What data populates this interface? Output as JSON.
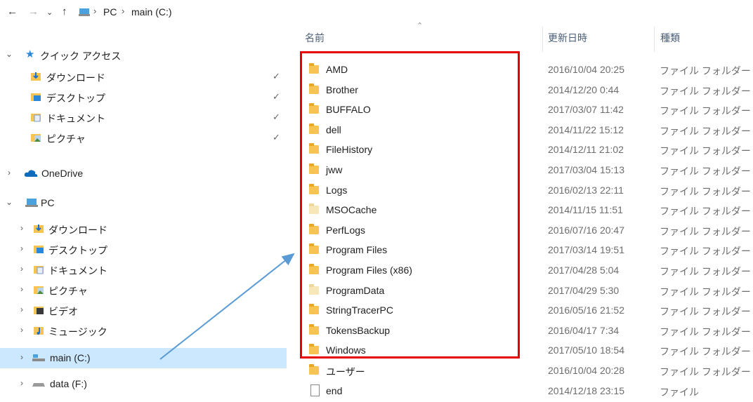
{
  "address_bar": {
    "back_icon": "arrow-left-icon",
    "forward_icon": "arrow-right-icon",
    "history_icon": "chevron-down-icon",
    "up_icon": "arrow-up-icon",
    "breadcrumbs": [
      "PC",
      "main (C:)"
    ]
  },
  "sidebar": {
    "quick_access": {
      "label": "クイック アクセス",
      "items": [
        {
          "label": "ダウンロード",
          "icon": "download-folder-icon"
        },
        {
          "label": "デスクトップ",
          "icon": "desktop-folder-icon"
        },
        {
          "label": "ドキュメント",
          "icon": "documents-folder-icon"
        },
        {
          "label": "ピクチャ",
          "icon": "pictures-folder-icon"
        }
      ]
    },
    "onedrive": {
      "label": "OneDrive"
    },
    "pc": {
      "label": "PC",
      "items": [
        {
          "label": "ダウンロード"
        },
        {
          "label": "デスクトップ"
        },
        {
          "label": "ドキュメント"
        },
        {
          "label": "ピクチャ"
        },
        {
          "label": "ビデオ"
        },
        {
          "label": "ミュージック"
        },
        {
          "label": "main (C:)",
          "selected": true
        },
        {
          "label": "data (F:)"
        }
      ]
    }
  },
  "columns": {
    "name": "名前",
    "date": "更新日時",
    "type": "種類"
  },
  "files": [
    {
      "name": "AMD",
      "date": "2016/10/04 20:25",
      "type": "ファイル フォルダー",
      "kind": "folder"
    },
    {
      "name": "Brother",
      "date": "2014/12/20 0:44",
      "type": "ファイル フォルダー",
      "kind": "folder"
    },
    {
      "name": "BUFFALO",
      "date": "2017/03/07 11:42",
      "type": "ファイル フォルダー",
      "kind": "folder"
    },
    {
      "name": "dell",
      "date": "2014/11/22 15:12",
      "type": "ファイル フォルダー",
      "kind": "folder"
    },
    {
      "name": "FileHistory",
      "date": "2014/12/11 21:02",
      "type": "ファイル フォルダー",
      "kind": "folder"
    },
    {
      "name": "jww",
      "date": "2017/03/04 15:13",
      "type": "ファイル フォルダー",
      "kind": "folder"
    },
    {
      "name": "Logs",
      "date": "2016/02/13 22:11",
      "type": "ファイル フォルダー",
      "kind": "folder"
    },
    {
      "name": "MSOCache",
      "date": "2014/11/15 11:51",
      "type": "ファイル フォルダー",
      "kind": "folder-hidden"
    },
    {
      "name": "PerfLogs",
      "date": "2016/07/16 20:47",
      "type": "ファイル フォルダー",
      "kind": "folder"
    },
    {
      "name": "Program Files",
      "date": "2017/03/14 19:51",
      "type": "ファイル フォルダー",
      "kind": "folder"
    },
    {
      "name": "Program Files (x86)",
      "date": "2017/04/28 5:04",
      "type": "ファイル フォルダー",
      "kind": "folder"
    },
    {
      "name": "ProgramData",
      "date": "2017/04/29 5:30",
      "type": "ファイル フォルダー",
      "kind": "folder-hidden"
    },
    {
      "name": "StringTracerPC",
      "date": "2016/05/16 21:52",
      "type": "ファイル フォルダー",
      "kind": "folder"
    },
    {
      "name": "TokensBackup",
      "date": "2016/04/17 7:34",
      "type": "ファイル フォルダー",
      "kind": "folder"
    },
    {
      "name": "Windows",
      "date": "2017/05/10 18:54",
      "type": "ファイル フォルダー",
      "kind": "folder"
    },
    {
      "name": "ユーザー",
      "date": "2016/10/04 20:28",
      "type": "ファイル フォルダー",
      "kind": "folder"
    },
    {
      "name": "end",
      "date": "2014/12/18 23:15",
      "type": "ファイル",
      "kind": "file"
    }
  ],
  "colors": {
    "highlight": "#e60000",
    "arrow": "#5b9bd5",
    "selected": "#cce8ff"
  }
}
